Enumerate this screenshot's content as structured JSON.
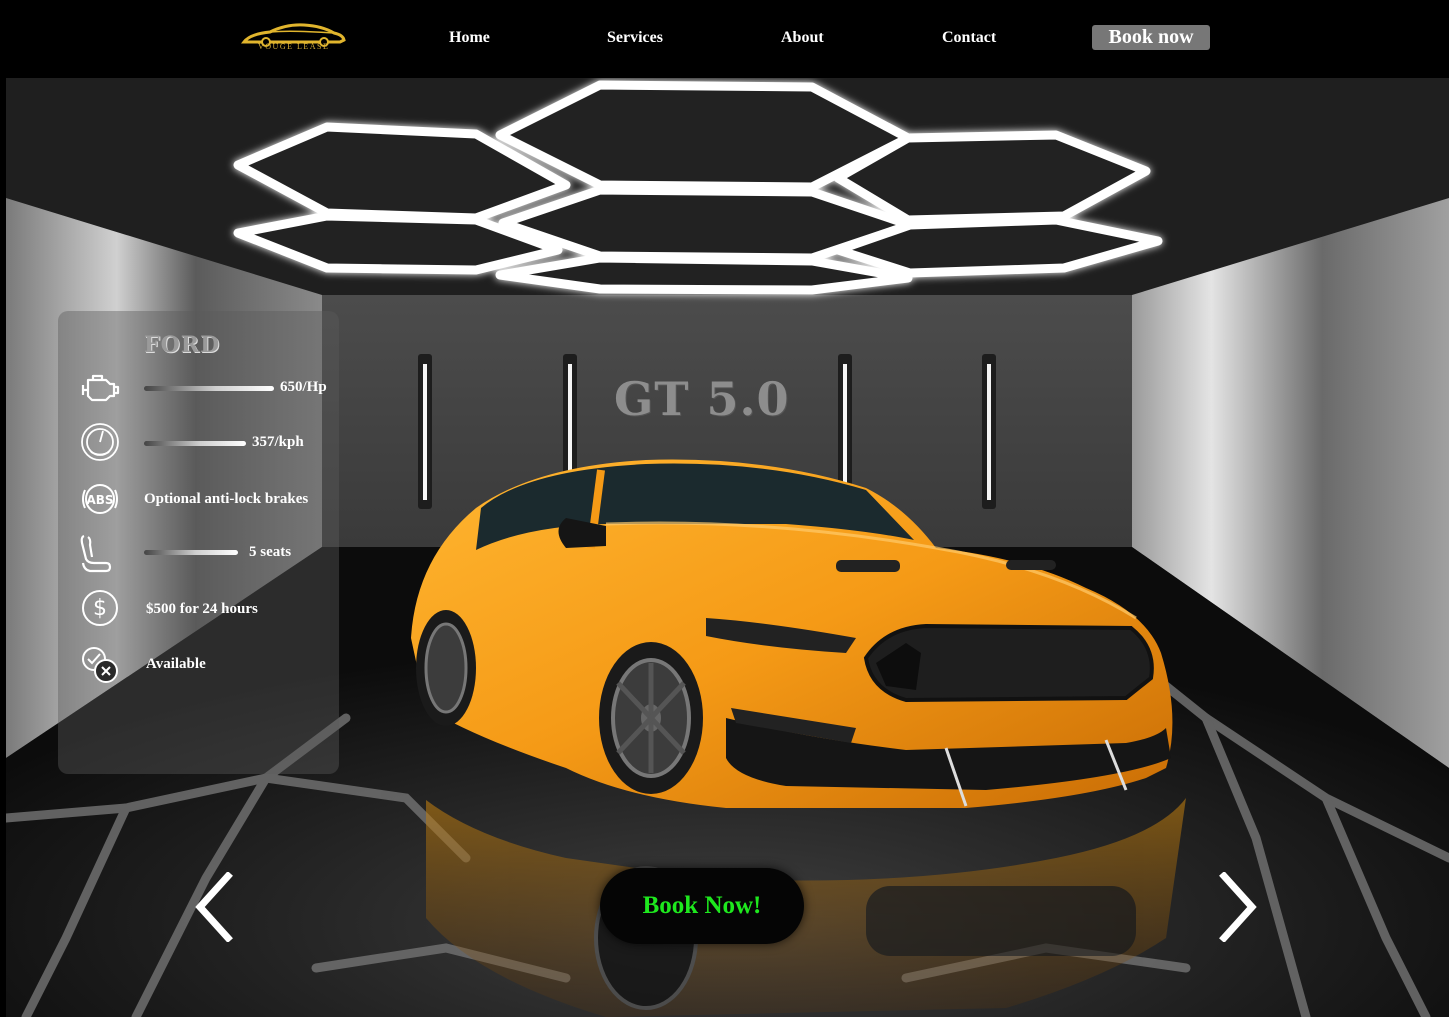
{
  "nav": {
    "logo_text": "VOUGE LEASE",
    "links": [
      {
        "label": "Home"
      },
      {
        "label": "Services"
      },
      {
        "label": "About"
      },
      {
        "label": "Contact"
      }
    ],
    "book_label": "Book now"
  },
  "car": {
    "make": "FORD",
    "model_title": "GT 5.0",
    "color": "#f59a16"
  },
  "specs": [
    {
      "icon": "engine-icon",
      "value": "650/Hp",
      "level": 0.7
    },
    {
      "icon": "speedometer-icon",
      "value": "357/kph",
      "level": 0.55
    },
    {
      "icon": "abs-icon",
      "value": "Optional anti-lock brakes"
    },
    {
      "icon": "seat-icon",
      "value": "5 seats",
      "level": 0.5
    },
    {
      "icon": "dollar-icon",
      "value": "$500 for 24 hours"
    },
    {
      "icon": "availability-icon",
      "value": "Available"
    }
  ],
  "cta": {
    "label": "Book Now!",
    "color": "#1ee81e"
  },
  "colors": {
    "background": "#000000",
    "nav_button": "#777777",
    "logo_gold": "#d8b13a"
  }
}
